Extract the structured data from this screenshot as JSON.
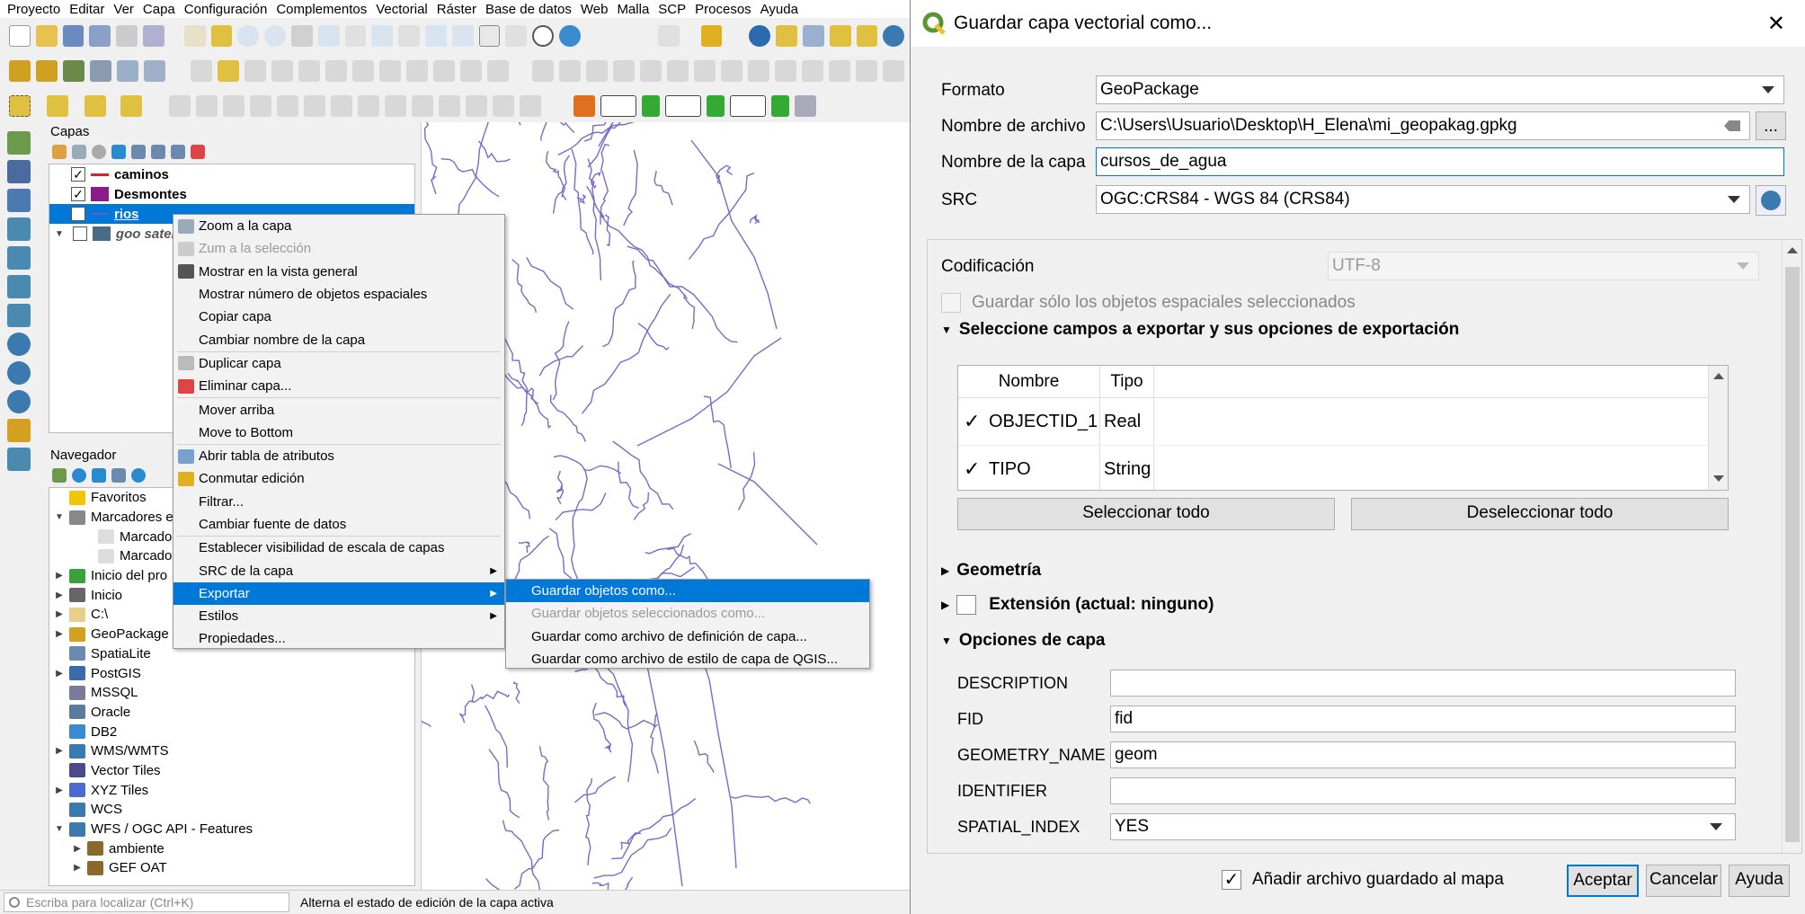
{
  "menubar": [
    "Proyecto",
    "Editar",
    "Ver",
    "Capa",
    "Configuración",
    "Complementos",
    "Vectorial",
    "Ráster",
    "Base de datos",
    "Web",
    "Malla",
    "SCP",
    "Procesos",
    "Ayuda"
  ],
  "layers_panel": {
    "title": "Capas",
    "layers": [
      {
        "name": "caminos",
        "checked": "✓",
        "symbol_color": "#e02020"
      },
      {
        "name": "Desmontes",
        "checked": "✓",
        "symbol_color": "#8b1a8b"
      },
      {
        "name": "rios",
        "checked": "✓",
        "symbol_color": "#6a5acd"
      },
      {
        "name": "goo satel",
        "checked": "",
        "symbol_color": "#4a6a8a"
      }
    ]
  },
  "navigator": {
    "title": "Navegador",
    "items": [
      {
        "label": "Favoritos",
        "arrow": "",
        "icon_color": "#f5c400"
      },
      {
        "label": "Marcadores e",
        "arrow": "▼",
        "icon_color": "#888888"
      },
      {
        "label": "Marcador",
        "arrow": "",
        "icon_color": "#dddddd"
      },
      {
        "label": "Marcador",
        "arrow": "",
        "icon_color": "#dddddd"
      },
      {
        "label": "Inicio del pro",
        "arrow": "▶",
        "icon_color": "#3aa23a"
      },
      {
        "label": "Inicio",
        "arrow": "▶",
        "icon_color": "#666666"
      },
      {
        "label": "C:\\",
        "arrow": "▶",
        "icon_color": "#e8d08a"
      },
      {
        "label": "GeoPackage",
        "arrow": "▶",
        "icon_color": "#d4a020"
      },
      {
        "label": "SpatiaLite",
        "arrow": "",
        "icon_color": "#6a8ab0"
      },
      {
        "label": "PostGIS",
        "arrow": "▶",
        "icon_color": "#3a6ab0"
      },
      {
        "label": "MSSQL",
        "arrow": "",
        "icon_color": "#7a7a9a"
      },
      {
        "label": "Oracle",
        "arrow": "",
        "icon_color": "#5a7aa0"
      },
      {
        "label": "DB2",
        "arrow": "",
        "icon_color": "#3a8ad0"
      },
      {
        "label": "WMS/WMTS",
        "arrow": "▶",
        "icon_color": "#3a7ab0"
      },
      {
        "label": "Vector Tiles",
        "arrow": "",
        "icon_color": "#4a4a8a"
      },
      {
        "label": "XYZ Tiles",
        "arrow": "▶",
        "icon_color": "#4a6ad0"
      },
      {
        "label": "WCS",
        "arrow": "",
        "icon_color": "#3a7ab0"
      },
      {
        "label": "WFS / OGC API - Features",
        "arrow": "▼",
        "icon_color": "#3a7ab0"
      },
      {
        "label": "ambiente",
        "arrow": "▶",
        "icon_color": "#8a6a2a"
      },
      {
        "label": "GEF OAT",
        "arrow": "▶",
        "icon_color": "#8a6a2a"
      }
    ]
  },
  "context_menu": {
    "items": [
      {
        "label": "Zoom a la capa",
        "state": "normal",
        "icon_color": "#9ab"
      },
      {
        "label": "Zum a la selección",
        "state": "disabled",
        "icon_color": "#ccc"
      },
      {
        "label": "Mostrar en la vista general",
        "state": "normal",
        "icon_color": "#555"
      },
      {
        "label": "Mostrar número de objetos espaciales",
        "state": "normal",
        "icon_color": ""
      },
      {
        "label": "Copiar capa",
        "state": "normal",
        "icon_color": ""
      },
      {
        "label": "Cambiar nombre de la capa",
        "state": "normal",
        "icon_color": ""
      },
      {
        "label": "Duplicar capa",
        "state": "normal",
        "icon_color": "#bbb"
      },
      {
        "label": "Eliminar capa...",
        "state": "normal",
        "icon_color": "#d44"
      },
      {
        "label": "Mover arriba",
        "state": "normal",
        "icon_color": ""
      },
      {
        "label": "Move to Bottom",
        "state": "normal",
        "icon_color": ""
      },
      {
        "label": "Abrir tabla de atributos",
        "state": "normal",
        "icon_color": "#7aa0d0"
      },
      {
        "label": "Conmutar edición",
        "state": "normal",
        "icon_color": "#e0b020"
      },
      {
        "label": "Filtrar...",
        "state": "normal",
        "icon_color": ""
      },
      {
        "label": "Cambiar fuente de datos",
        "state": "normal",
        "icon_color": ""
      },
      {
        "label": "Establecer visibilidad de escala de capas",
        "state": "normal",
        "icon_color": ""
      },
      {
        "label": "SRC de la capa",
        "state": "normal",
        "icon_color": "",
        "submenu": "▶"
      },
      {
        "label": "Exportar",
        "state": "active",
        "icon_color": "",
        "submenu": "▶"
      },
      {
        "label": "Estilos",
        "state": "normal",
        "icon_color": "",
        "submenu": "▶"
      },
      {
        "label": "Propiedades...",
        "state": "normal",
        "icon_color": ""
      }
    ],
    "submenu": [
      {
        "label": "Guardar objetos como...",
        "state": "active"
      },
      {
        "label": "Guardar objetos seleccionados como...",
        "state": "disabled"
      },
      {
        "label": "Guardar como archivo de definición de capa...",
        "state": "normal"
      },
      {
        "label": "Guardar como archivo de estilo de capa de QGIS...",
        "state": "normal"
      }
    ]
  },
  "statusbar": {
    "locator_placeholder": "Escriba para localizar (Ctrl+K)",
    "message": "Alterna el estado de edición de la capa activa"
  },
  "dialog": {
    "title": "Guardar capa vectorial como...",
    "close": "✕",
    "format_label": "Formato",
    "format_value": "GeoPackage",
    "filename_label": "Nombre de archivo",
    "filename_value": "C:\\Users\\Usuario\\Desktop\\H_Elena\\mi_geopakag.gpkg",
    "browse_label": "...",
    "layername_label": "Nombre de la capa",
    "layername_value": "cursos_de_agua",
    "crs_label": "SRC",
    "crs_value": "OGC:CRS84 - WGS 84 (CRS84)",
    "encoding_label": "Codificación",
    "encoding_value": "UTF-8",
    "selected_only_label": "Guardar sólo los objetos espaciales seleccionados",
    "fields_section": "Seleccione campos a exportar y sus opciones de exportación",
    "fields_headers": [
      "Nombre",
      "Tipo"
    ],
    "fields": [
      {
        "name": "OBJECTID_1",
        "type": "Real",
        "checked": "✓"
      },
      {
        "name": "TIPO",
        "type": "String",
        "checked": "✓"
      }
    ],
    "select_all": "Seleccionar todo",
    "deselect_all": "Deseleccionar todo",
    "geometry_section": "Geometría",
    "extent_section": "Extensión (actual: ninguno)",
    "layer_options_section": "Opciones de capa",
    "layer_options": [
      {
        "key": "DESCRIPTION",
        "value": ""
      },
      {
        "key": "FID",
        "value": "fid"
      },
      {
        "key": "GEOMETRY_NAME",
        "value": "geom"
      },
      {
        "key": "IDENTIFIER",
        "value": ""
      },
      {
        "key": "SPATIAL_INDEX",
        "value": "YES"
      }
    ],
    "add_to_map_label": "Añadir archivo guardado al mapa",
    "add_to_map_checked": "✓",
    "ok": "Aceptar",
    "cancel": "Cancelar",
    "help": "Ayuda"
  },
  "colors": {
    "selection": "#0078d7",
    "river_lines": "#7a6ac8"
  }
}
